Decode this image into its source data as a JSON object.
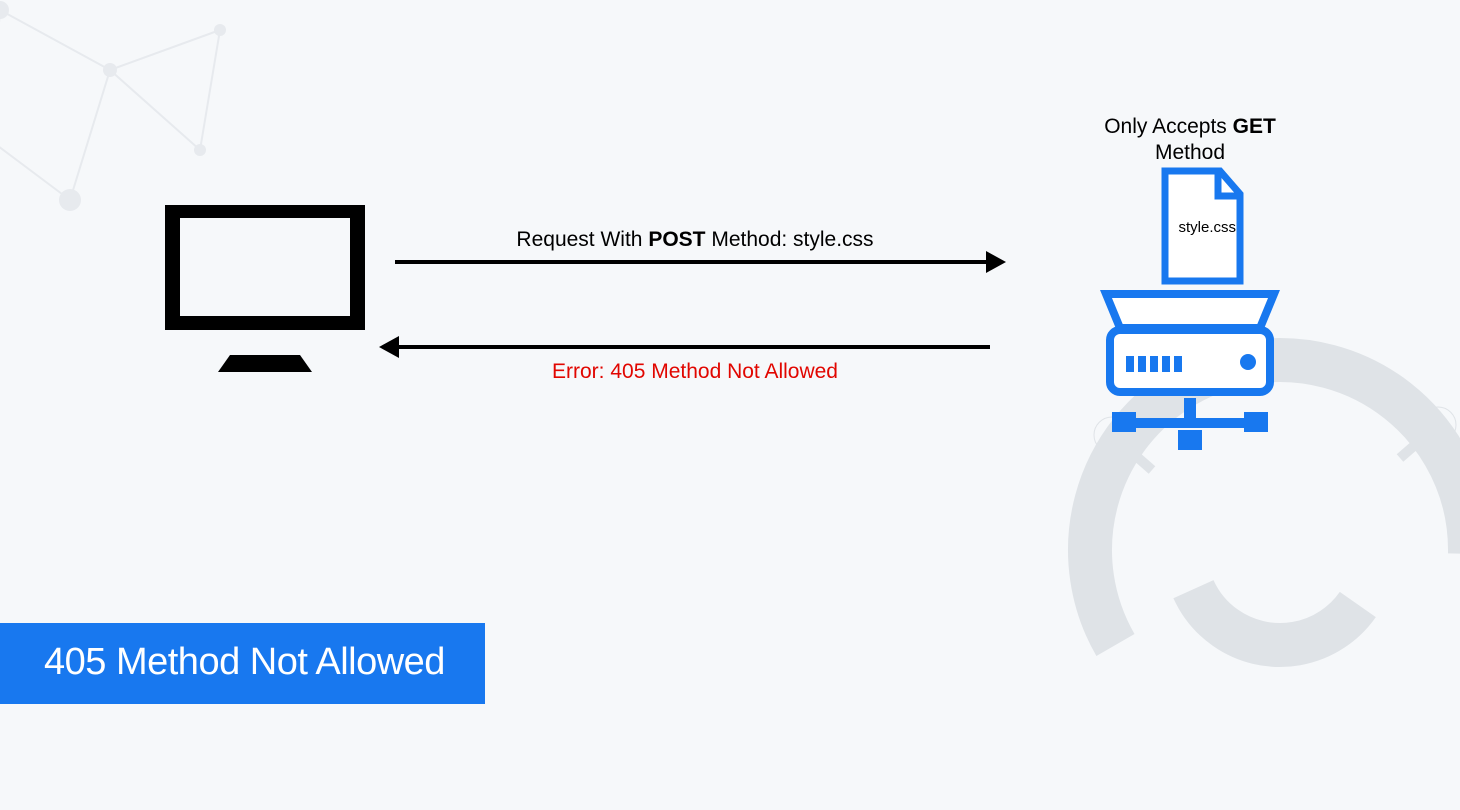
{
  "title_bar": "405 Method Not Allowed",
  "server_caption_prefix": "Only Accepts ",
  "server_caption_bold": "GET",
  "server_caption_suffix": " Method",
  "file_name": "style.css",
  "request_prefix": "Request With ",
  "request_bold": "POST",
  "request_suffix": " Method: style.css",
  "error_text": "Error: 405 Method Not Allowed",
  "colors": {
    "accent_blue": "#1878ef",
    "error_red": "#e10600"
  }
}
